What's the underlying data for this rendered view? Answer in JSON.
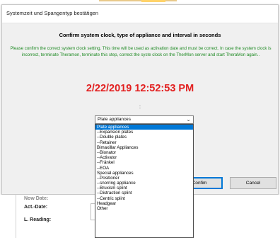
{
  "dialog": {
    "title": "Systemzeit und Spangentyp bestätigen",
    "heading": "Confirm system clock, type of appliance and interval in seconds",
    "instructions": "Please confirm the correct system clock setting. This time will be used as activation date and must be correct. In case the system clock is incorrect, terminate Theramon, terminate this step, correct the syste clock on the TherMon server and start TheraMon again..",
    "clock": "2/22/2019 12:52:53 PM",
    "interval_separator": ":",
    "confirm_label": "Confim",
    "cancel_label": "Cancel"
  },
  "appliance": {
    "selected": "Plate appliances",
    "options": [
      "Plate appliances",
      "--Expansion plates",
      "--Double plates",
      "--Retainer",
      "Bimaxillar Appliances",
      "--Bionator",
      "--Activator",
      "--Fränkel",
      "--EOA",
      "Special appliances",
      "--Positioner",
      "--snorring appliance",
      "--Bruxism splint",
      "--Distraction splint",
      "--Centric splint",
      "Headgear",
      "Other"
    ],
    "highlighted_index": 0
  },
  "background_form": {
    "label_partial": "Now Date:",
    "act_date_label": "Act.-Date:",
    "last_reading_label": "L. Reading:"
  },
  "colors": {
    "clock": "#e21f1f",
    "instructions": "#1f8a24",
    "selection": "#0078d7"
  }
}
